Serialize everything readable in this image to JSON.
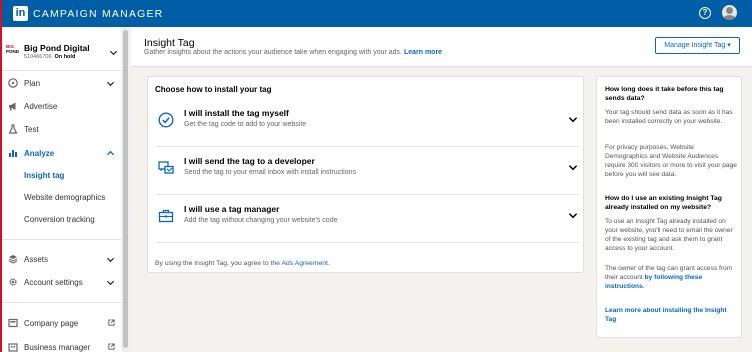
{
  "app": {
    "logo_text": "in",
    "title": "CAMPAIGN MANAGER"
  },
  "account": {
    "name": "Big Pond Digital",
    "id": "510466706",
    "status": "On hold",
    "logo_top": "BIG",
    "logo_bottom": "POND"
  },
  "nav": {
    "plan": "Plan",
    "advertise": "Advertise",
    "test": "Test",
    "analyze": "Analyze",
    "analyze_sub": [
      "Insight tag",
      "Website demographics",
      "Conversion tracking"
    ],
    "assets": "Assets",
    "account_settings": "Account settings",
    "company_page": "Company page",
    "business_manager": "Business manager"
  },
  "header": {
    "title": "Insight Tag",
    "subtitle": "Gather insights about the actions your audience take when engaging with your ads.",
    "learn_more": "Learn more",
    "manage_button": "Manage Insight Tag"
  },
  "install": {
    "heading": "Choose how to install your tag",
    "options": [
      {
        "title": "I will install the tag myself",
        "desc": "Get the tag code to add to your website"
      },
      {
        "title": "I will send the tag to a developer",
        "desc": "Send the tag to your email inbox with install instructions"
      },
      {
        "title": "I will use a tag manager",
        "desc": "Add the tag without changing your website's code"
      }
    ],
    "footer_prefix": "By using the Insight Tag, you agree to the",
    "footer_link": "Ads Agreement",
    "footer_suffix": "."
  },
  "faq": {
    "q1": "How long does it take before this tag sends data?",
    "a1": "Your tag should send data as soon as it has been installed correctly on your website.",
    "a1b": "For privacy purposes, Website Demographics and Website Audiences require 300 visitors or more to visit your page before you will see data.",
    "q2": "How do I use an existing Insight Tag already installed on my website?",
    "a2": "To use an Insight Tag already installed on your website, you'll need to email the owner of the existing tag and ask them to grant access to your account.",
    "a2b_prefix": "The owner of the tag can grant access from their account",
    "a2b_link": "by following these instructions",
    "a2b_suffix": ".",
    "learn_link": "Learn more about installing the Insight Tag"
  },
  "colors": {
    "brand": "#005ea6",
    "link": "#0a66c2",
    "alert": "#d11124"
  },
  "icons": [
    "help-icon",
    "avatar",
    "chevron-down-icon",
    "chevron-up-icon",
    "compass-icon",
    "megaphone-icon",
    "flask-icon",
    "chart-icon",
    "gear-icon",
    "assets-icon",
    "external-link-icon",
    "check-circle-icon",
    "chat-send-icon",
    "briefcase-icon"
  ]
}
